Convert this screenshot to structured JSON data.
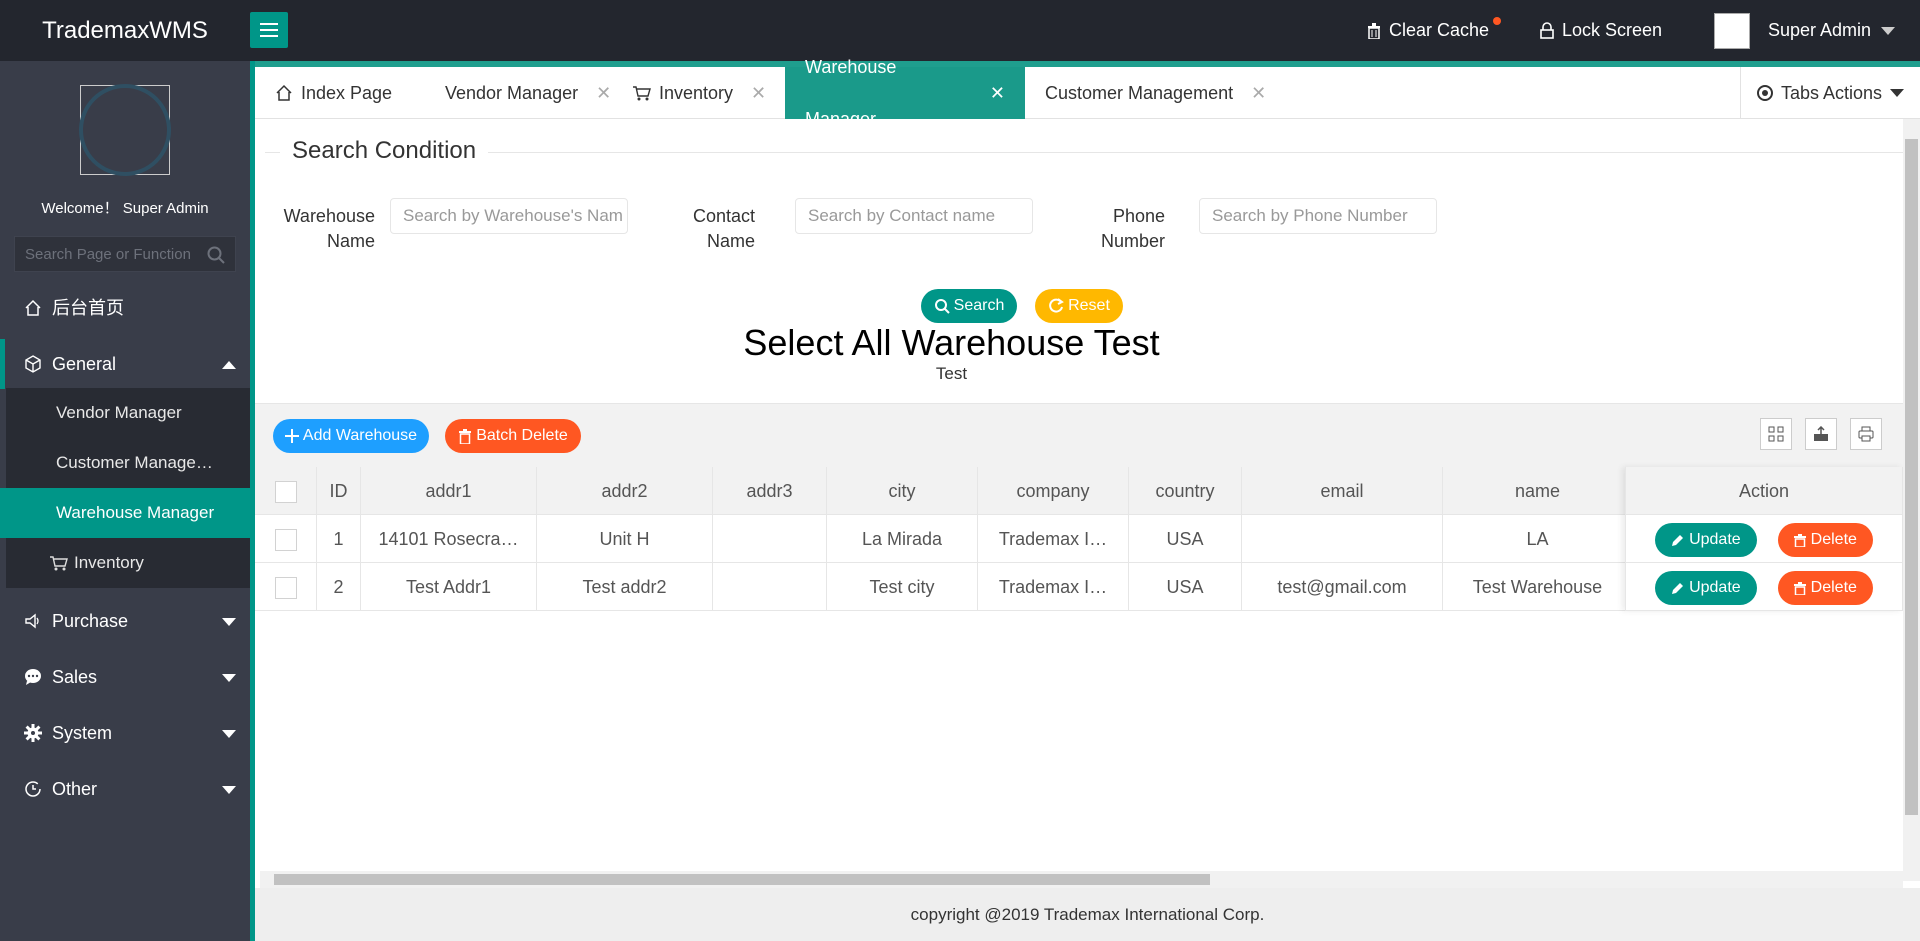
{
  "app": {
    "title": "TrademaxWMS"
  },
  "header": {
    "clear_cache": "Clear Cache",
    "lock_screen": "Lock Screen",
    "user_name": "Super Admin"
  },
  "sidebar": {
    "welcome": "Welcome！ Super Admin",
    "search_placeholder": "Search Page or Function",
    "home": "后台首页",
    "general": "General",
    "sub_items": [
      "Vendor Manager",
      "Customer Manage…",
      "Warehouse Manager",
      "Inventory"
    ],
    "purchase": "Purchase",
    "sales": "Sales",
    "system": "System",
    "other": "Other"
  },
  "tabs": {
    "items": [
      "Index Page",
      "Vendor Manager",
      "Inventory",
      "Warehouse Manager",
      "Customer Management"
    ],
    "active": "Warehouse Manager",
    "actions": "Tabs Actions"
  },
  "search": {
    "legend": "Search Condition",
    "warehouse_label": "Warehouse Name",
    "warehouse_placeholder": "Search by Warehouse's Nam",
    "contact_label": "Contact Name",
    "contact_placeholder": "Search by Contact name",
    "phone_label": "Phone Number",
    "phone_placeholder": "Search by Phone Number",
    "search_btn": "Search",
    "reset_btn": "Reset"
  },
  "heading": {
    "title": "Select All Warehouse Test",
    "subtitle": "Test"
  },
  "toolbar": {
    "add": "Add Warehouse",
    "batch_delete": "Batch Delete"
  },
  "table": {
    "columns": [
      "ID",
      "addr1",
      "addr2",
      "addr3",
      "city",
      "company",
      "country",
      "email",
      "name",
      "Action"
    ],
    "rows": [
      [
        "1",
        "14101 Rosecra…",
        "Unit H",
        "",
        "La Mirada",
        "Trademax I…",
        "USA",
        "",
        "LA"
      ],
      [
        "2",
        "Test Addr1",
        "Test addr2",
        "",
        "Test city",
        "Trademax I…",
        "USA",
        "test@gmail.com",
        "Test Warehouse"
      ]
    ],
    "update_label": "Update",
    "delete_label": "Delete"
  },
  "footer": {
    "text": "copyright @2019 Trademax International Corp."
  },
  "colors": {
    "teal": "#009688",
    "blue": "#1e9fff",
    "orange": "#ff5722",
    "yellow": "#ffb800",
    "dark": "#23262e",
    "sidebar": "#393d49"
  }
}
